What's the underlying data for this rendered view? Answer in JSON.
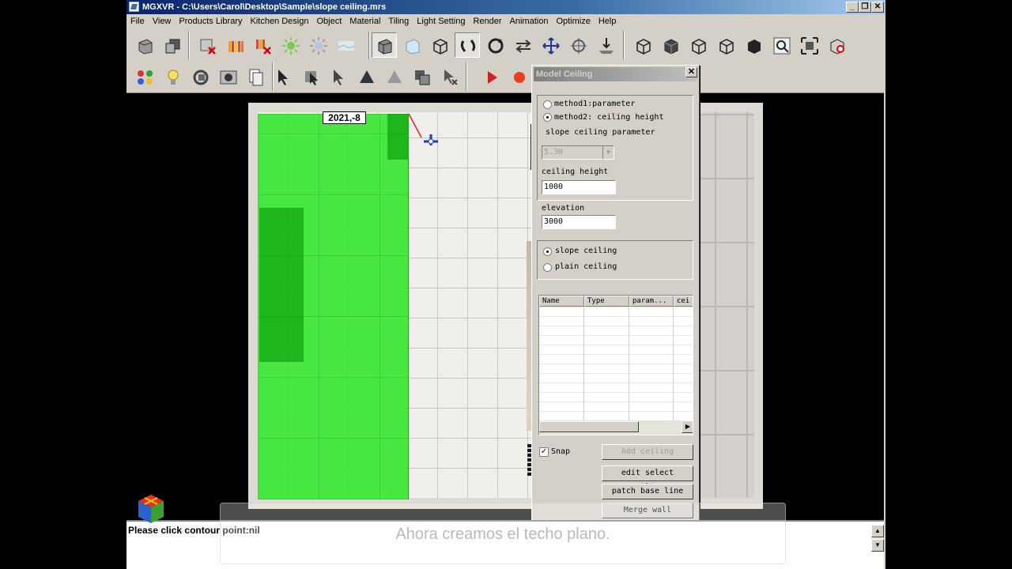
{
  "window": {
    "title": "MGXVR - C:\\Users\\Carol\\Desktop\\Sample\\slope ceiling.mrs"
  },
  "menu": [
    "File",
    "View",
    "Products Library",
    "Kitchen Design",
    "Object",
    "Material",
    "Tiling",
    "Light Setting",
    "Render",
    "Animation",
    "Optimize",
    "Help"
  ],
  "viewport": {
    "coordinate_readout": "2021,-8"
  },
  "dialog": {
    "title": "Model Ceiling",
    "method1_label": "method1:parameter",
    "method2_label": "method2: ceiling height",
    "method_selected": "method2",
    "slope_param_label": "slope ceiling parameter",
    "slope_param_value": "5.30",
    "ceiling_height_label": "ceiling height",
    "ceiling_height_value": "1000",
    "elevation_label": "elevation",
    "elevation_value": "3000",
    "slope_ceiling_label": "slope ceiling",
    "plain_ceiling_label": "plain ceiling",
    "ceiling_type_selected": "slope",
    "grid_headers": [
      "Name",
      "Type",
      "param...",
      "cei"
    ],
    "snap_label": "Snap",
    "snap_checked": true,
    "add_ceiling": "Add ceiling",
    "edit_select_ceiling": "edit select ceiling",
    "patch_base_line": "patch base line",
    "merge_wall": "Merge wall"
  },
  "status": {
    "text": "Please click contour point:nil"
  },
  "caption": "Ahora creamos el techo plano."
}
